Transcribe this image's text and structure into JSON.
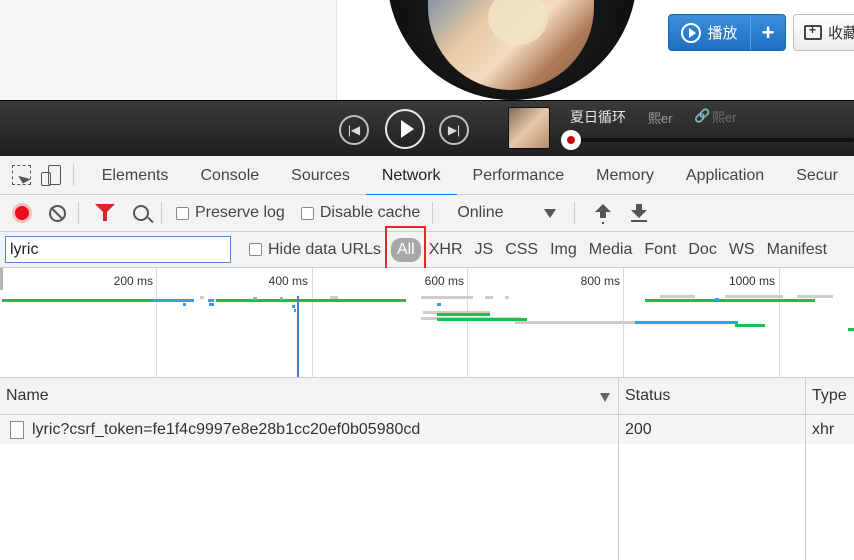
{
  "web_page": {
    "play_button_label": "播放",
    "add_button_label": "+",
    "collect_button_label": "收藏"
  },
  "player": {
    "song_title": "夏日循环",
    "artist": "熙er",
    "share_text": "熙er",
    "progress": 0.02
  },
  "devtools": {
    "tabs": [
      "Elements",
      "Console",
      "Sources",
      "Network",
      "Performance",
      "Memory",
      "Application",
      "Secur"
    ],
    "active_tab": "Network",
    "toolbar": {
      "preserve_log": "Preserve log",
      "disable_cache": "Disable cache",
      "throttling": "Online"
    },
    "filter": {
      "value": "lyric",
      "hide_data_urls": "Hide data URLs",
      "types": [
        "All",
        "XHR",
        "JS",
        "CSS",
        "Img",
        "Media",
        "Font",
        "Doc",
        "WS",
        "Manifest"
      ],
      "active_type": "All"
    },
    "overview": {
      "time_labels": [
        "200 ms",
        "400 ms",
        "600 ms",
        "800 ms",
        "1000 ms"
      ]
    },
    "table": {
      "columns": [
        "Name",
        "Status",
        "Type"
      ],
      "rows": [
        {
          "name": "lyric?csrf_token=fe1f4c9997e8e28b1cc20ef0b05980cd",
          "status": "200",
          "type": "xhr"
        }
      ]
    }
  },
  "colors": {
    "accent_blue": "#1a73e8",
    "record_red": "#e8101a",
    "highlight_red": "#e12727",
    "bar_green": "#1bbf4c",
    "bar_blue": "#2ea3e6"
  }
}
